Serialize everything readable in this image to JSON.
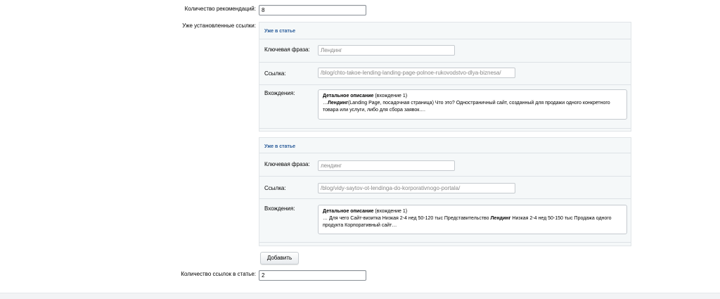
{
  "recommendations": {
    "label": "Количество рекомендаций:",
    "value": "8"
  },
  "existing_links": {
    "label": "Уже установленные ссылки:",
    "items": [
      {
        "title": "Уже в статье",
        "keyword_label": "Ключевая фраза:",
        "keyword": "Лендинг",
        "link_label": "Ссылка:",
        "link": "/blog/chto-takoe-lending-landing-page-polnoe-rukovodstvo-dlya-biznesa/",
        "occurrences_label": "Вхождения:",
        "occ_title": "Детальное описание",
        "occ_count": " (вхождение 1)",
        "occ_pre": "…",
        "occ_bold": "Лендинг",
        "occ_post": "(Landing Page, посадочная страница) Что это?  Одностраничный сайт, созданный для продажи одного конкретного товара или услуги, либо для сбора заявок.…"
      },
      {
        "title": "Уже в статье",
        "keyword_label": "Ключевая фраза:",
        "keyword": "лендинг",
        "link_label": "Ссылка:",
        "link": "/blog/vidy-saytov-ot-lendinga-do-korporativnogo-portala/",
        "occurrences_label": "Вхождения:",
        "occ_title": "Детальное описание",
        "occ_count": " (вхождение 1)",
        "occ_pre": "… Для чего  Сайт-визитка  Низкая  2-4 нед  50-120 тыс  Представительство  ",
        "occ_bold": "Лендинг",
        "occ_post": " Низкая  2-4 нед  50-150 тыс  Продажа одного продукта  Корпоративный сайт…"
      }
    ]
  },
  "add_button": "Добавить",
  "links_in_article": {
    "label": "Количество ссылок в статье:",
    "value": "2"
  }
}
